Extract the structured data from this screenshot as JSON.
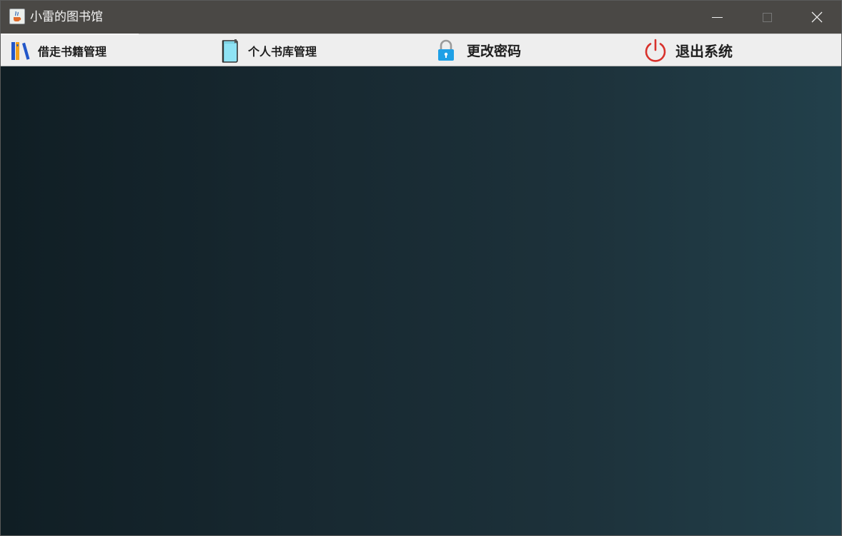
{
  "window": {
    "title": "小雷的图书馆",
    "app_icon": "java-cup-icon",
    "controls": {
      "minimize_icon": "minimize-icon",
      "maximize_icon": "maximize-icon",
      "close_icon": "close-icon"
    }
  },
  "toolbar": {
    "items": [
      {
        "label": "借走书籍管理",
        "icon": "books-icon"
      },
      {
        "label": "个人书库管理",
        "icon": "book-icon"
      },
      {
        "label": "更改密码",
        "icon": "lock-icon"
      },
      {
        "label": "退出系统",
        "icon": "power-icon"
      }
    ]
  },
  "colors": {
    "titlebar": "#4a4845",
    "toolbar": "#eeeeee",
    "content_gradient_start": "#101e24",
    "content_gradient_end": "#22404b",
    "lock_blue": "#1fa0e6",
    "power_red": "#d8312b",
    "book_cyan": "#8fe3f5"
  }
}
